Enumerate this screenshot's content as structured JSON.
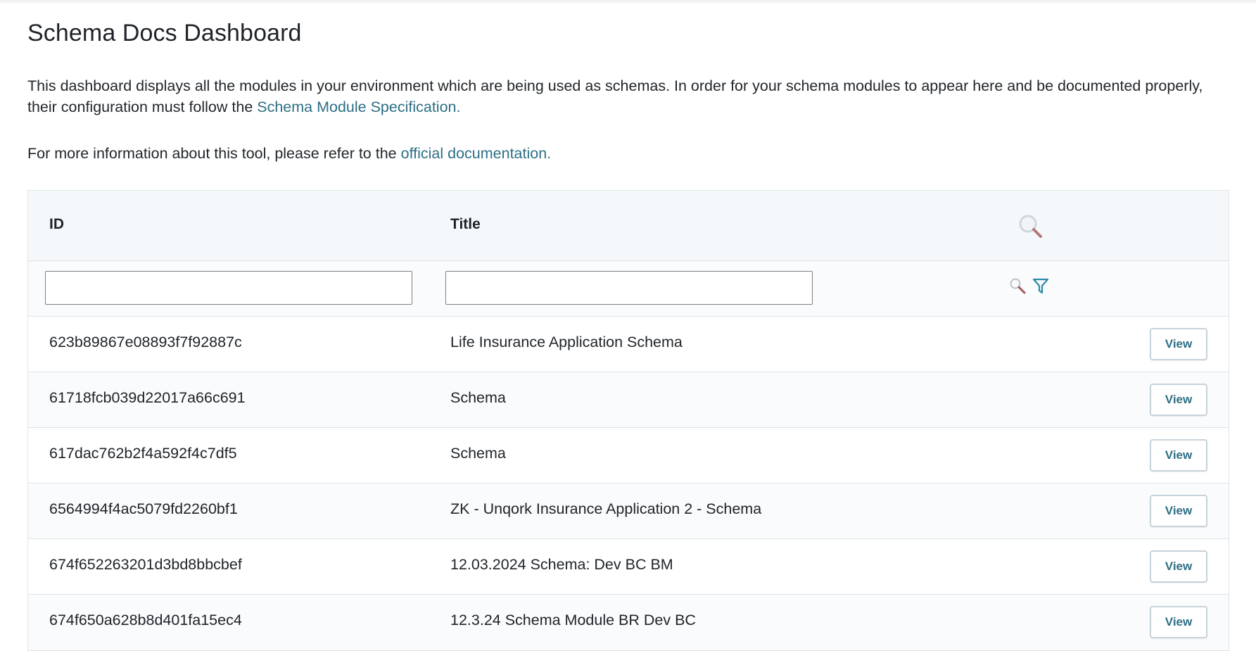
{
  "page": {
    "title": "Schema Docs Dashboard",
    "description_part1": "This dashboard displays all the modules in your environment which are being used as schemas. In order for your schema modules to appear here and be documented properly, their configuration must follow the ",
    "description_link": "Schema Module Specification.",
    "info_part1": "For more information about this tool, please refer to the ",
    "info_link": "official documentation."
  },
  "table": {
    "columns": {
      "id": "ID",
      "title": "Title"
    },
    "filters": {
      "id_value": "",
      "title_value": ""
    },
    "view_label": "View",
    "rows": [
      {
        "id": "623b89867e08893f7f92887c",
        "title": "Life Insurance Application Schema"
      },
      {
        "id": "61718fcb039d22017a66c691",
        "title": "Schema"
      },
      {
        "id": "617dac762b2f4a592f4c7df5",
        "title": "Schema"
      },
      {
        "id": "6564994f4ac5079fd2260bf1",
        "title": "ZK - Unqork Insurance Application 2 - Schema"
      },
      {
        "id": "674f652263201d3bd8bbcbef",
        "title": "12.03.2024 Schema: Dev BC BM"
      },
      {
        "id": "674f650a628b8d401fa15ec4",
        "title": "12.3.24 Schema Module BR Dev BC"
      }
    ]
  },
  "colors": {
    "link": "#2d6f85",
    "header_bg": "#f5f8fa",
    "border": "#dfe4e8"
  },
  "icons": {
    "header": "search-icon",
    "filter_search": "search-icon",
    "filter": "filter-icon"
  }
}
